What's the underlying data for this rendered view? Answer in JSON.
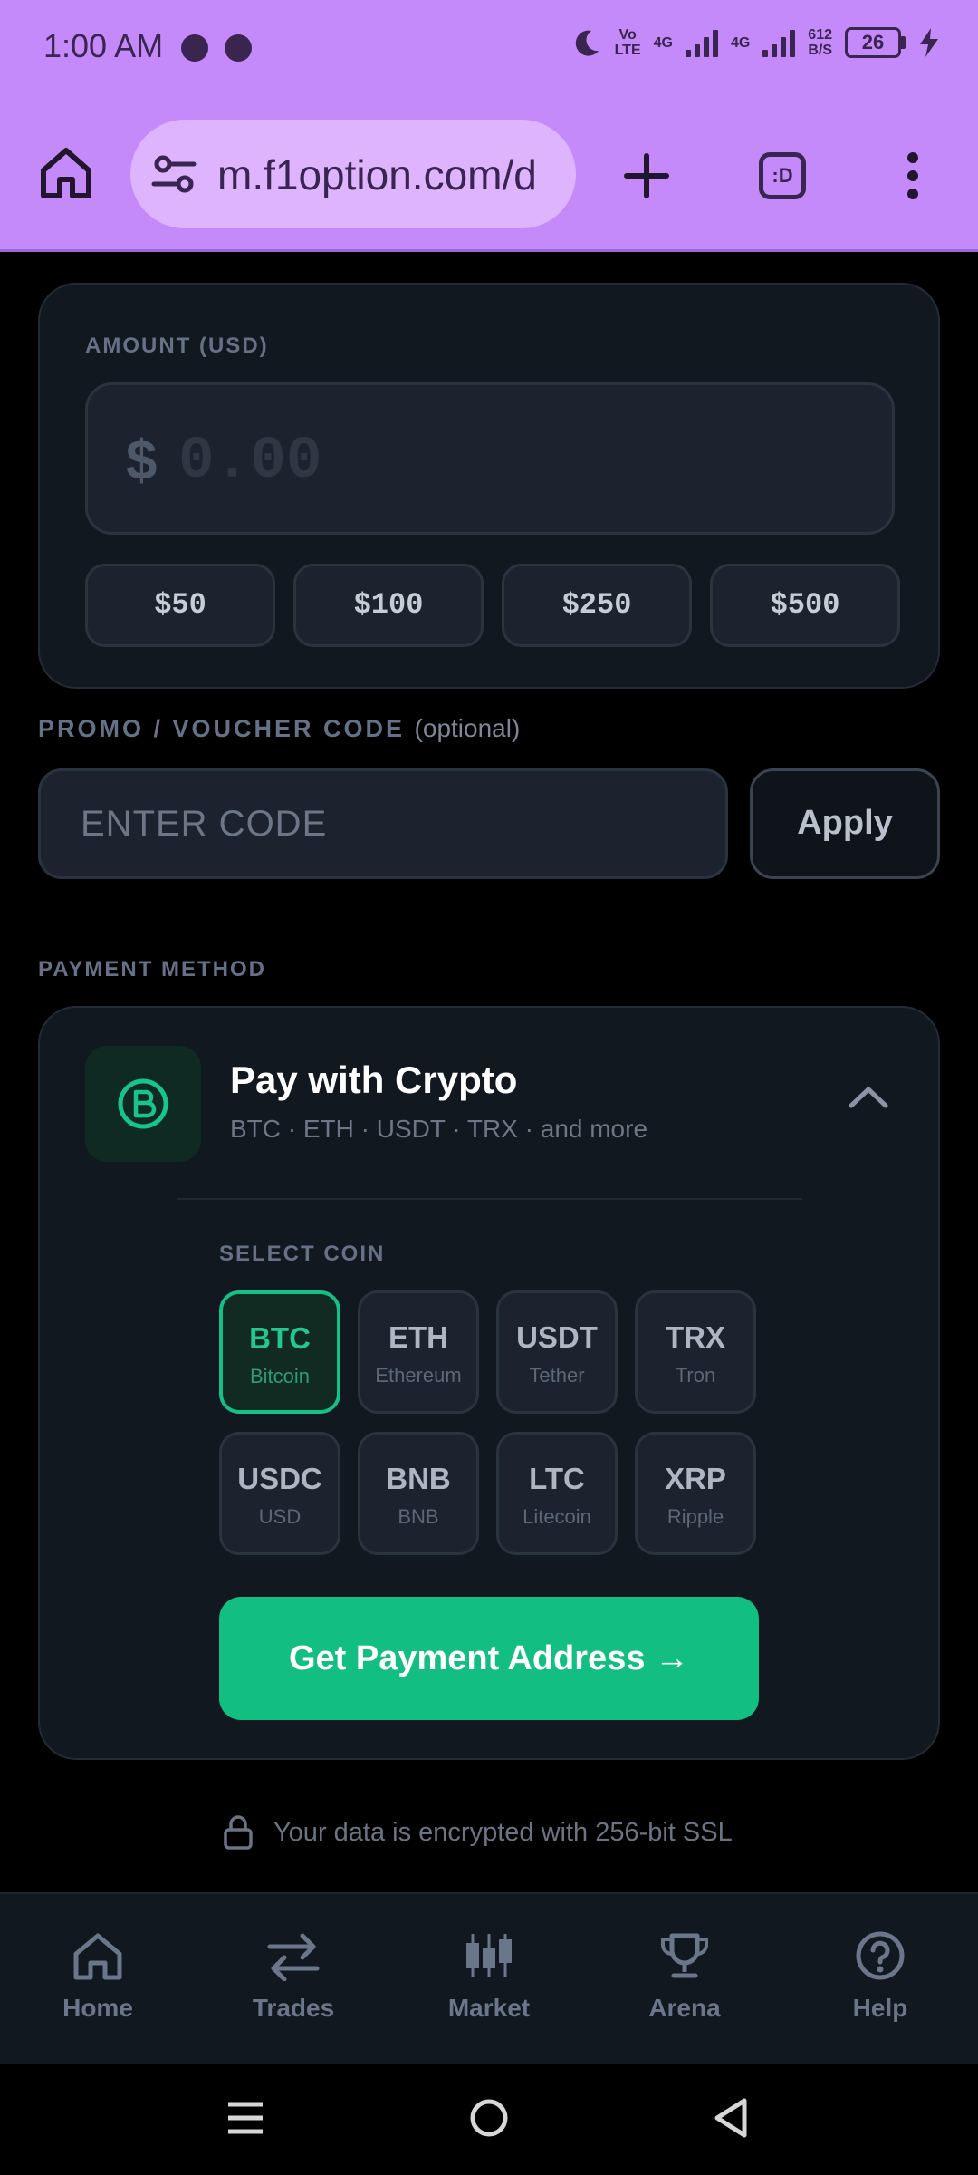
{
  "status_bar": {
    "time": "1:00 AM",
    "volte_line1": "Vo",
    "volte_line2": "LTE",
    "net1": "4G",
    "net2": "4G",
    "speed_value": "612",
    "speed_unit": "B/S",
    "battery": "26",
    "icons": [
      "chat-icon",
      "notification-icon",
      "moon-icon",
      "signal-icon",
      "battery-icon",
      "charging-icon"
    ]
  },
  "browser": {
    "url": "m.f1option.com/d",
    "tabs_label": ":D",
    "icons": [
      "home-icon",
      "site-settings-icon",
      "new-tab-icon",
      "tabs-icon",
      "menu-icon"
    ]
  },
  "amount": {
    "label": "AMOUNT (USD)",
    "currency_symbol": "$",
    "placeholder": "0.00",
    "quick_amounts": [
      "$50",
      "$100",
      "$250",
      "$500"
    ]
  },
  "promo": {
    "label": "PROMO / VOUCHER CODE",
    "optional": "(optional)",
    "placeholder": "ENTER CODE",
    "apply_label": "Apply"
  },
  "payment": {
    "section_label": "PAYMENT METHOD",
    "method_title": "Pay with Crypto",
    "method_subtitle": "BTC · ETH · USDT · TRX · and more",
    "select_coin_label": "SELECT COIN",
    "coins": [
      {
        "symbol": "BTC",
        "name": "Bitcoin",
        "selected": true
      },
      {
        "symbol": "ETH",
        "name": "Ethereum",
        "selected": false
      },
      {
        "symbol": "USDT",
        "name": "Tether",
        "selected": false
      },
      {
        "symbol": "TRX",
        "name": "Tron",
        "selected": false
      },
      {
        "symbol": "USDC",
        "name": "USD",
        "selected": false
      },
      {
        "symbol": "BNB",
        "name": "BNB",
        "selected": false
      },
      {
        "symbol": "LTC",
        "name": "Litecoin",
        "selected": false
      },
      {
        "symbol": "XRP",
        "name": "Ripple",
        "selected": false
      }
    ],
    "cta_label": "Get Payment Address →"
  },
  "security_note": "Your data is encrypted with 256-bit SSL",
  "bottom_nav": [
    {
      "label": "Home",
      "icon": "home-icon"
    },
    {
      "label": "Trades",
      "icon": "transfer-icon"
    },
    {
      "label": "Market",
      "icon": "candlestick-icon"
    },
    {
      "label": "Arena",
      "icon": "trophy-icon"
    },
    {
      "label": "Help",
      "icon": "help-icon"
    }
  ],
  "colors": {
    "browser_bar": "#c58af9",
    "background": "#000000",
    "card": "#121820",
    "accent": "#13be82",
    "muted_text": "#657186"
  }
}
